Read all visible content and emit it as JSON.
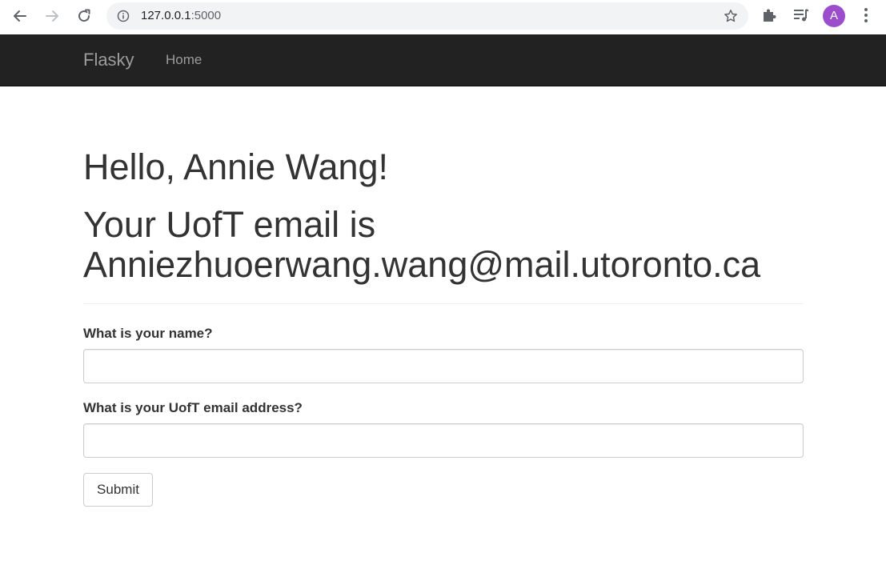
{
  "browser": {
    "url_host": "127.0.0.1",
    "url_port": ":5000",
    "avatar_letter": "A",
    "avatar_color": "#9c4dcc",
    "icons": {
      "back": "back-arrow-icon",
      "forward": "forward-arrow-icon",
      "reload": "reload-icon",
      "site_info": "info-icon",
      "bookmark": "star-icon",
      "extensions": "puzzle-piece-icon",
      "reading_list": "reading-list-icon",
      "menu": "three-dots-vertical-icon"
    }
  },
  "navbar": {
    "brand": "Flasky",
    "links": [
      {
        "label": "Home"
      }
    ],
    "background": "#222222",
    "link_color": "#9d9d9d"
  },
  "main": {
    "greeting": "Hello, Annie Wang!",
    "email_line1": "Your UofT email is",
    "email_line2": "Anniezhuoerwang.wang@mail.utoronto.ca"
  },
  "form": {
    "name_label": "What is your name?",
    "name_value": "",
    "email_label": "What is your UofT email address?",
    "email_value": "",
    "submit_label": "Submit"
  }
}
